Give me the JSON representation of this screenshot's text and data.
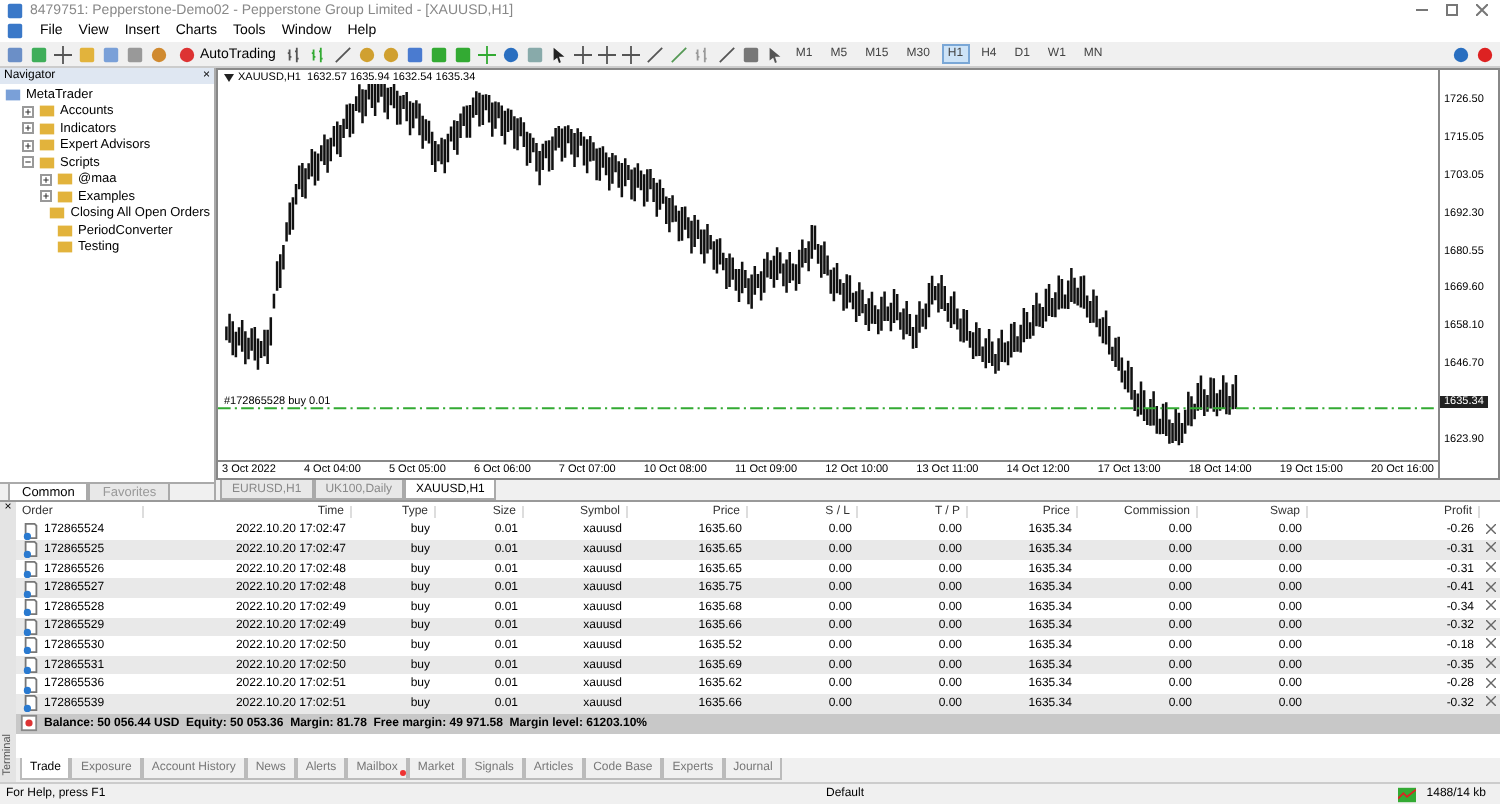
{
  "window": {
    "title": "8479751: Pepperstone-Demo02 - Pepperstone Group Limited - [XAUUSD,H1]"
  },
  "menu": [
    "File",
    "View",
    "Insert",
    "Charts",
    "Tools",
    "Window",
    "Help"
  ],
  "toolbar": {
    "autotrading": "AutoTrading",
    "timeframes": [
      {
        "label": "M1",
        "selected": false
      },
      {
        "label": "M5",
        "selected": false
      },
      {
        "label": "M15",
        "selected": false
      },
      {
        "label": "M30",
        "selected": false
      },
      {
        "label": "H1",
        "selected": true
      },
      {
        "label": "H4",
        "selected": false
      },
      {
        "label": "D1",
        "selected": false
      },
      {
        "label": "W1",
        "selected": false
      },
      {
        "label": "MN",
        "selected": false
      }
    ]
  },
  "navigator": {
    "title": "Navigator",
    "close": "×",
    "tree": [
      {
        "label": "MetaTrader",
        "children": [
          {
            "label": "Accounts",
            "expanded": false
          },
          {
            "label": "Indicators",
            "expanded": false
          },
          {
            "label": "Expert Advisors",
            "expanded": false
          },
          {
            "label": "Scripts",
            "expanded": true,
            "children": [
              {
                "label": "@maa",
                "expanded": false
              },
              {
                "label": "Examples",
                "expanded": false
              },
              {
                "label": "Closing All Open Orders"
              },
              {
                "label": "PeriodConverter"
              },
              {
                "label": "Testing"
              }
            ]
          }
        ]
      }
    ],
    "tabs": [
      {
        "label": "Common",
        "selected": true
      },
      {
        "label": "Favorites",
        "selected": false
      }
    ]
  },
  "chart": {
    "header": "XAUUSD,H1  1632.57 1635.94 1632.54 1635.34",
    "order_line": "#172865528 buy 0.01",
    "current_price": "1635.34",
    "price_axis": [
      "1726.50",
      "1715.05",
      "1703.05",
      "1692.30",
      "1680.55",
      "1669.60",
      "1658.10",
      "1646.70",
      "1623.90"
    ],
    "time_axis": [
      "3 Oct 2022",
      "4 Oct 04:00",
      "5 Oct 05:00",
      "6 Oct 06:00",
      "7 Oct 07:00",
      "10 Oct 08:00",
      "11 Oct 09:00",
      "12 Oct 10:00",
      "13 Oct 11:00",
      "14 Oct 12:00",
      "17 Oct 13:00",
      "18 Oct 14:00",
      "19 Oct 15:00",
      "20 Oct 16:00"
    ],
    "tabs": [
      {
        "label": "EURUSD,H1",
        "selected": false
      },
      {
        "label": "UK100,Daily",
        "selected": false
      },
      {
        "label": "XAUUSD,H1",
        "selected": true
      }
    ]
  },
  "terminal": {
    "label": "Terminal",
    "close": "×",
    "columns": [
      "Order",
      "Time",
      "Type",
      "Size",
      "Symbol",
      "Price",
      "S / L",
      "T / P",
      "Price",
      "Commission",
      "Swap",
      "Profit"
    ],
    "rows": [
      [
        "172865524",
        "2022.10.20 17:02:47",
        "buy",
        "0.01",
        "xauusd",
        "1635.60",
        "0.00",
        "0.00",
        "1635.34",
        "0.00",
        "0.00",
        "-0.26"
      ],
      [
        "172865525",
        "2022.10.20 17:02:47",
        "buy",
        "0.01",
        "xauusd",
        "1635.65",
        "0.00",
        "0.00",
        "1635.34",
        "0.00",
        "0.00",
        "-0.31"
      ],
      [
        "172865526",
        "2022.10.20 17:02:48",
        "buy",
        "0.01",
        "xauusd",
        "1635.65",
        "0.00",
        "0.00",
        "1635.34",
        "0.00",
        "0.00",
        "-0.31"
      ],
      [
        "172865527",
        "2022.10.20 17:02:48",
        "buy",
        "0.01",
        "xauusd",
        "1635.75",
        "0.00",
        "0.00",
        "1635.34",
        "0.00",
        "0.00",
        "-0.41"
      ],
      [
        "172865528",
        "2022.10.20 17:02:49",
        "buy",
        "0.01",
        "xauusd",
        "1635.68",
        "0.00",
        "0.00",
        "1635.34",
        "0.00",
        "0.00",
        "-0.34"
      ],
      [
        "172865529",
        "2022.10.20 17:02:49",
        "buy",
        "0.01",
        "xauusd",
        "1635.66",
        "0.00",
        "0.00",
        "1635.34",
        "0.00",
        "0.00",
        "-0.32"
      ],
      [
        "172865530",
        "2022.10.20 17:02:50",
        "buy",
        "0.01",
        "xauusd",
        "1635.52",
        "0.00",
        "0.00",
        "1635.34",
        "0.00",
        "0.00",
        "-0.18"
      ],
      [
        "172865531",
        "2022.10.20 17:02:50",
        "buy",
        "0.01",
        "xauusd",
        "1635.69",
        "0.00",
        "0.00",
        "1635.34",
        "0.00",
        "0.00",
        "-0.35"
      ],
      [
        "172865536",
        "2022.10.20 17:02:51",
        "buy",
        "0.01",
        "xauusd",
        "1635.62",
        "0.00",
        "0.00",
        "1635.34",
        "0.00",
        "0.00",
        "-0.28"
      ],
      [
        "172865539",
        "2022.10.20 17:02:51",
        "buy",
        "0.01",
        "xauusd",
        "1635.66",
        "0.00",
        "0.00",
        "1635.34",
        "0.00",
        "0.00",
        "-0.32"
      ]
    ],
    "summary": "Balance: 50 056.44 USD  Equity: 50 053.36  Margin: 81.78  Free margin: 49 971.58  Margin level: 61203.10%",
    "tabs": [
      {
        "label": "Trade",
        "selected": true,
        "badge": false
      },
      {
        "label": "Exposure",
        "selected": false,
        "badge": false
      },
      {
        "label": "Account History",
        "selected": false,
        "badge": false
      },
      {
        "label": "News",
        "selected": false,
        "badge": false
      },
      {
        "label": "Alerts",
        "selected": false,
        "badge": false
      },
      {
        "label": "Mailbox",
        "selected": false,
        "badge": true
      },
      {
        "label": "Market",
        "selected": false,
        "badge": false
      },
      {
        "label": "Signals",
        "selected": false,
        "badge": false
      },
      {
        "label": "Articles",
        "selected": false,
        "badge": false
      },
      {
        "label": "Code Base",
        "selected": false,
        "badge": false
      },
      {
        "label": "Experts",
        "selected": false,
        "badge": false
      },
      {
        "label": "Journal",
        "selected": false,
        "badge": false
      }
    ]
  },
  "status_bar": {
    "help": "For Help, press F1",
    "profile": "Default",
    "traffic": "1488/14 kb"
  }
}
